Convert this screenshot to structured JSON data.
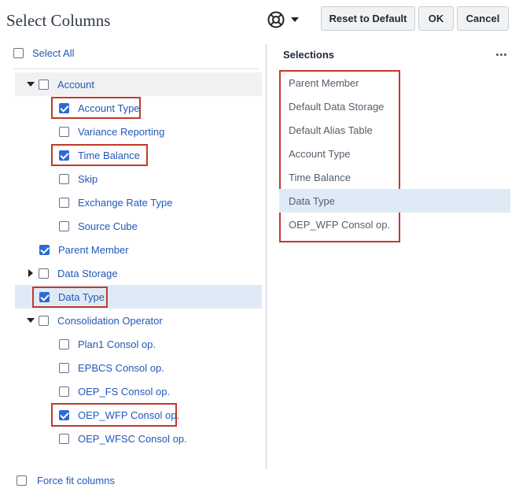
{
  "dialog": {
    "title": "Select Columns",
    "help_icon": "lifebuoy-icon",
    "buttons": {
      "reset": "Reset to Default",
      "ok": "OK",
      "cancel": "Cancel"
    }
  },
  "left": {
    "select_all": {
      "label": "Select All",
      "checked": false
    },
    "tree": [
      {
        "label": "Account",
        "checked": false,
        "expander": "expanded",
        "level": 0
      },
      {
        "label": "Account Type",
        "checked": true,
        "level": 1
      },
      {
        "label": "Variance Reporting",
        "checked": false,
        "level": 1
      },
      {
        "label": "Time Balance",
        "checked": true,
        "level": 1
      },
      {
        "label": "Skip",
        "checked": false,
        "level": 1
      },
      {
        "label": "Exchange Rate Type",
        "checked": false,
        "level": 1
      },
      {
        "label": "Source Cube",
        "checked": false,
        "level": 1
      },
      {
        "label": "Parent Member",
        "checked": true,
        "level": 0
      },
      {
        "label": "Data Storage",
        "checked": false,
        "expander": "collapsed",
        "level": 0
      },
      {
        "label": "Data Type",
        "checked": true,
        "level": 0
      },
      {
        "label": "Consolidation Operator",
        "checked": false,
        "expander": "expanded",
        "level": 0
      },
      {
        "label": "Plan1 Consol op.",
        "checked": false,
        "level": 1
      },
      {
        "label": "EPBCS Consol op.",
        "checked": false,
        "level": 1
      },
      {
        "label": "OEP_FS Consol op.",
        "checked": false,
        "level": 1
      },
      {
        "label": "OEP_WFP Consol op.",
        "checked": true,
        "level": 1
      },
      {
        "label": "OEP_WFSC Consol op.",
        "checked": false,
        "level": 1
      }
    ],
    "force_fit": {
      "label": "Force fit columns",
      "checked": false
    }
  },
  "right": {
    "title": "Selections",
    "more_icon": "more-horizontal-icon",
    "items": [
      "Parent Member",
      "Default Data Storage",
      "Default Alias Table",
      "Account Type",
      "Time Balance",
      "Data Type",
      "OEP_WFP Consol op."
    ],
    "selected_item": "Data Type"
  },
  "colors": {
    "link_blue": "#2358b8",
    "checkbox_blue": "#2d6ad8",
    "highlight_red": "#c0392b",
    "row_selected": "#deebf6",
    "row_shaded": "#f0f1f2"
  }
}
